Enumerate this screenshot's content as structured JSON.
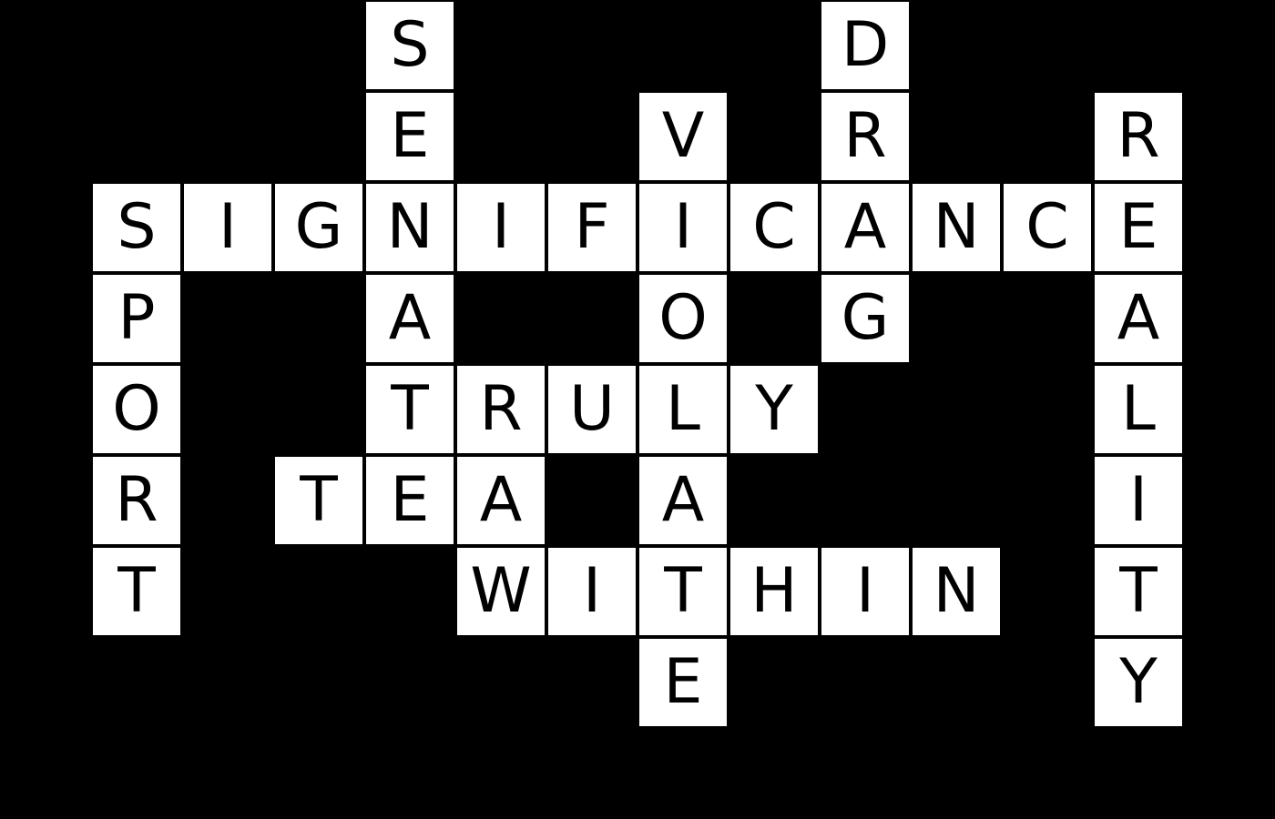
{
  "board": {
    "cell_color": "#ffffff",
    "background_color": "#000000",
    "letter_color": "#000000",
    "columns": 14,
    "rows": 9
  },
  "cells": [
    {
      "row": 0,
      "col": 4,
      "letter": "S"
    },
    {
      "row": 0,
      "col": 9,
      "letter": "D"
    },
    {
      "row": 1,
      "col": 4,
      "letter": "E"
    },
    {
      "row": 1,
      "col": 7,
      "letter": "V"
    },
    {
      "row": 1,
      "col": 9,
      "letter": "R"
    },
    {
      "row": 1,
      "col": 12,
      "letter": "R"
    },
    {
      "row": 2,
      "col": 1,
      "letter": "S"
    },
    {
      "row": 2,
      "col": 2,
      "letter": "I"
    },
    {
      "row": 2,
      "col": 3,
      "letter": "G"
    },
    {
      "row": 2,
      "col": 4,
      "letter": "N"
    },
    {
      "row": 2,
      "col": 5,
      "letter": "I"
    },
    {
      "row": 2,
      "col": 6,
      "letter": "F"
    },
    {
      "row": 2,
      "col": 7,
      "letter": "I"
    },
    {
      "row": 2,
      "col": 8,
      "letter": "C"
    },
    {
      "row": 2,
      "col": 9,
      "letter": "A"
    },
    {
      "row": 2,
      "col": 10,
      "letter": "N"
    },
    {
      "row": 2,
      "col": 11,
      "letter": "C"
    },
    {
      "row": 2,
      "col": 12,
      "letter": "E"
    },
    {
      "row": 3,
      "col": 1,
      "letter": "P"
    },
    {
      "row": 3,
      "col": 4,
      "letter": "A"
    },
    {
      "row": 3,
      "col": 7,
      "letter": "O"
    },
    {
      "row": 3,
      "col": 9,
      "letter": "G"
    },
    {
      "row": 3,
      "col": 12,
      "letter": "A"
    },
    {
      "row": 4,
      "col": 1,
      "letter": "O"
    },
    {
      "row": 4,
      "col": 4,
      "letter": "T"
    },
    {
      "row": 4,
      "col": 5,
      "letter": "R"
    },
    {
      "row": 4,
      "col": 6,
      "letter": "U"
    },
    {
      "row": 4,
      "col": 7,
      "letter": "L"
    },
    {
      "row": 4,
      "col": 8,
      "letter": "Y"
    },
    {
      "row": 4,
      "col": 12,
      "letter": "L"
    },
    {
      "row": 5,
      "col": 1,
      "letter": "R"
    },
    {
      "row": 5,
      "col": 3,
      "letter": "T"
    },
    {
      "row": 5,
      "col": 4,
      "letter": "E"
    },
    {
      "row": 5,
      "col": 5,
      "letter": "A"
    },
    {
      "row": 5,
      "col": 7,
      "letter": "A"
    },
    {
      "row": 5,
      "col": 12,
      "letter": "I"
    },
    {
      "row": 6,
      "col": 1,
      "letter": "T"
    },
    {
      "row": 6,
      "col": 5,
      "letter": "W"
    },
    {
      "row": 6,
      "col": 6,
      "letter": "I"
    },
    {
      "row": 6,
      "col": 7,
      "letter": "T"
    },
    {
      "row": 6,
      "col": 8,
      "letter": "H"
    },
    {
      "row": 6,
      "col": 9,
      "letter": "I"
    },
    {
      "row": 6,
      "col": 10,
      "letter": "N"
    },
    {
      "row": 6,
      "col": 12,
      "letter": "T"
    },
    {
      "row": 7,
      "col": 7,
      "letter": "E"
    },
    {
      "row": 7,
      "col": 12,
      "letter": "Y"
    }
  ]
}
